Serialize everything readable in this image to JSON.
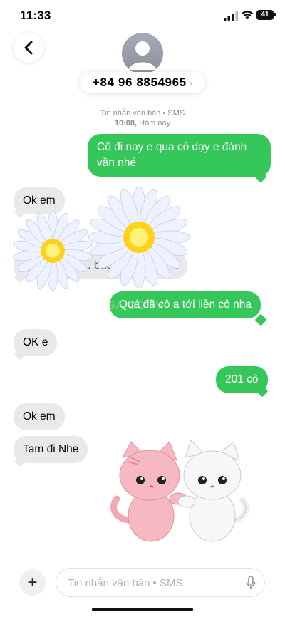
{
  "status_bar": {
    "time": "11:33",
    "battery": "41"
  },
  "header": {
    "back_icon": "chevron-left-icon",
    "avatar_icon": "person-silhouette-icon",
    "contact": "+84 96 8854965",
    "contact_chevron": "›"
  },
  "thread_meta": {
    "line1": "Tin nhắn văn bản • SMS",
    "line2_time": "10:08,",
    "line2_day": "Hôm nay"
  },
  "messages": [
    {
      "direction": "outgoing",
      "text": "Cô đi nay e qua cô dạy e đánh vần nhé"
    },
    {
      "direction": "incoming",
      "text": "Ok em"
    },
    {
      "direction": "incoming",
      "text": ".. bao",
      "trailing": "?",
      "partial": true
    },
    {
      "direction": "outgoing",
      "text": "Quá đã cô a tới liền cô nha"
    },
    {
      "direction": "incoming",
      "text": "OK e"
    },
    {
      "direction": "outgoing",
      "text": "201 cô"
    },
    {
      "direction": "incoming",
      "text": "Ok em"
    },
    {
      "direction": "incoming",
      "text": "Tam đi Nhe"
    }
  ],
  "watermark": "GAIGO TV",
  "stickers": [
    "daisy-flower-sticker",
    "daisy-flower-sticker",
    "cat-couple-sticker"
  ],
  "composer": {
    "placeholder": "Tin nhắn văn bản • SMS",
    "plus_icon": "plus-icon",
    "mic_icon": "microphone-icon",
    "plus_label": "+"
  },
  "colors": {
    "outgoing": "#35c759",
    "incoming": "#e9e9eb",
    "meta": "#8e8e93"
  }
}
